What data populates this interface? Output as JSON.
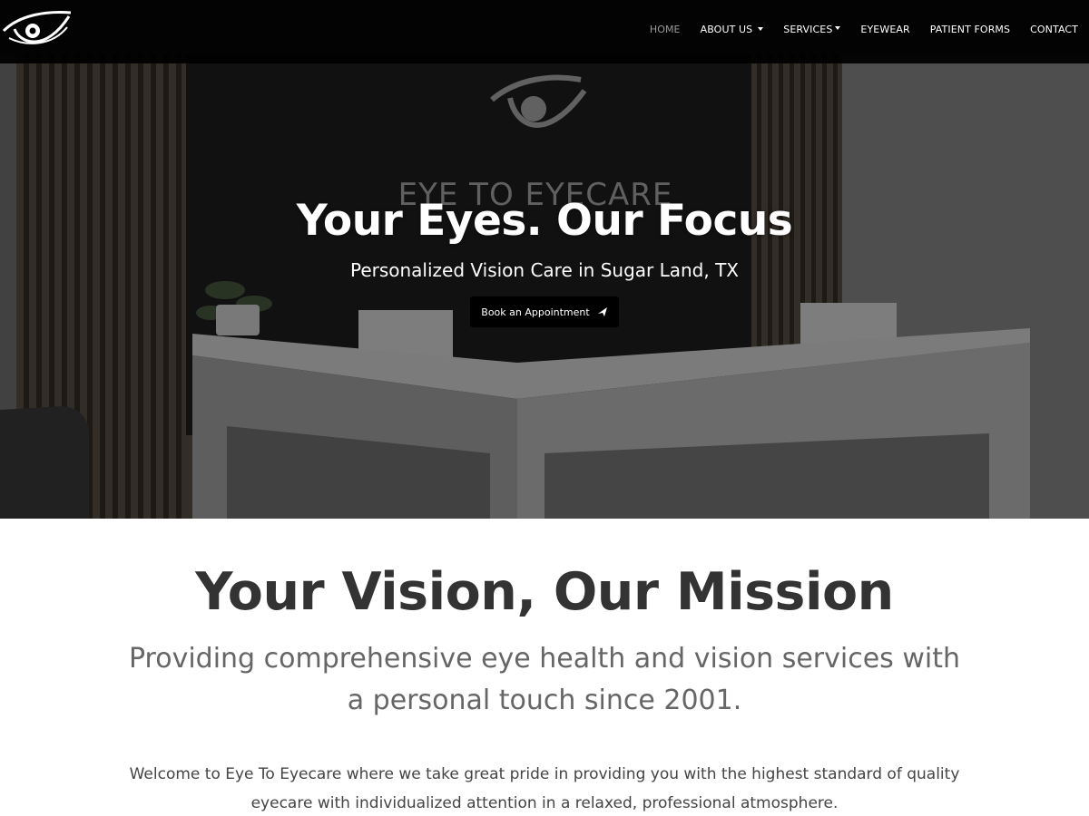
{
  "brand": {
    "logo_icon": "eye-logo-icon"
  },
  "nav": {
    "items": [
      {
        "label": "HOME",
        "active": true,
        "dropdown": false
      },
      {
        "label": "ABOUT US",
        "active": false,
        "dropdown": true
      },
      {
        "label": "SERVICES",
        "active": false,
        "dropdown": true
      },
      {
        "label": "EYEWEAR",
        "active": false,
        "dropdown": false
      },
      {
        "label": "PATIENT FORMS",
        "active": false,
        "dropdown": false
      },
      {
        "label": "CONTACT",
        "active": false,
        "dropdown": false
      }
    ]
  },
  "hero": {
    "wall_sign": "EYE TO EYECARE",
    "title": "Your Eyes. Our Focus",
    "subtitle": "Personalized Vision Care in Sugar Land, TX",
    "cta_label": "Book an Appointment",
    "cta_icon": "send-arrow-icon"
  },
  "mission": {
    "title": "Your Vision, Our Mission",
    "subtitle": "Providing comprehensive eye health and vision services with a personal touch since 2001.",
    "welcome": "Welcome to Eye To Eyecare where we take great pride in providing you with the highest standard of quality eyecare with individualized attention in a relaxed, professional atmosphere."
  },
  "colors": {
    "navbar_bg": "#000000",
    "nav_active": "#9a9a9a",
    "nav_text": "#ffffff",
    "button_bg": "#000000",
    "heading_text": "#333333",
    "subheading_text": "#666666"
  }
}
